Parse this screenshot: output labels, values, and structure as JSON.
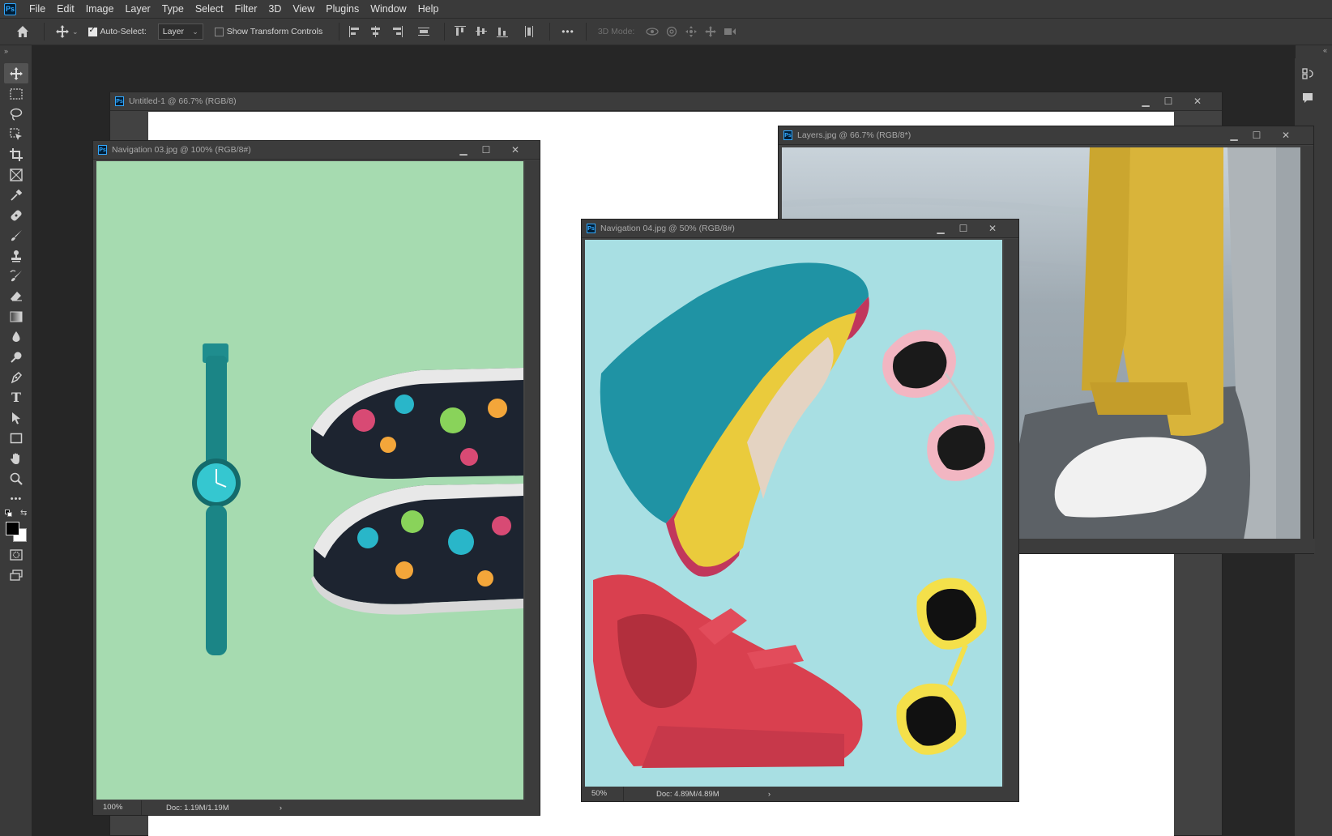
{
  "app": {
    "logo": "Ps"
  },
  "menu": [
    "File",
    "Edit",
    "Image",
    "Layer",
    "Type",
    "Select",
    "Filter",
    "3D",
    "View",
    "Plugins",
    "Window",
    "Help"
  ],
  "options": {
    "auto_select_label": "Auto-Select:",
    "auto_select_checked": true,
    "layer_select_value": "Layer",
    "transform_label": "Show Transform Controls",
    "transform_checked": false,
    "mode_3d_label": "3D Mode:",
    "more_glyph": "•••"
  },
  "documents": {
    "untitled": {
      "title": "Untitled-1 @ 66.7% (RGB/8)"
    },
    "nav03": {
      "title": "Navigation 03.jpg @ 100% (RGB/8#)",
      "zoom": "100%",
      "doc": "Doc: 1.19M/1.19M"
    },
    "layers": {
      "title": "Layers.jpg @ 66.7% (RGB/8*)"
    },
    "nav04": {
      "title": "Navigation 04.jpg @ 50% (RGB/8#)",
      "zoom": "50%",
      "doc": "Doc: 4.89M/4.89M"
    }
  },
  "colors": {
    "nav03_bg": "#a6dbb0",
    "nav04_bg": "#a8dfe3",
    "layers_bg": "#9aa7b0",
    "accent_blue": "#31a8ff"
  }
}
